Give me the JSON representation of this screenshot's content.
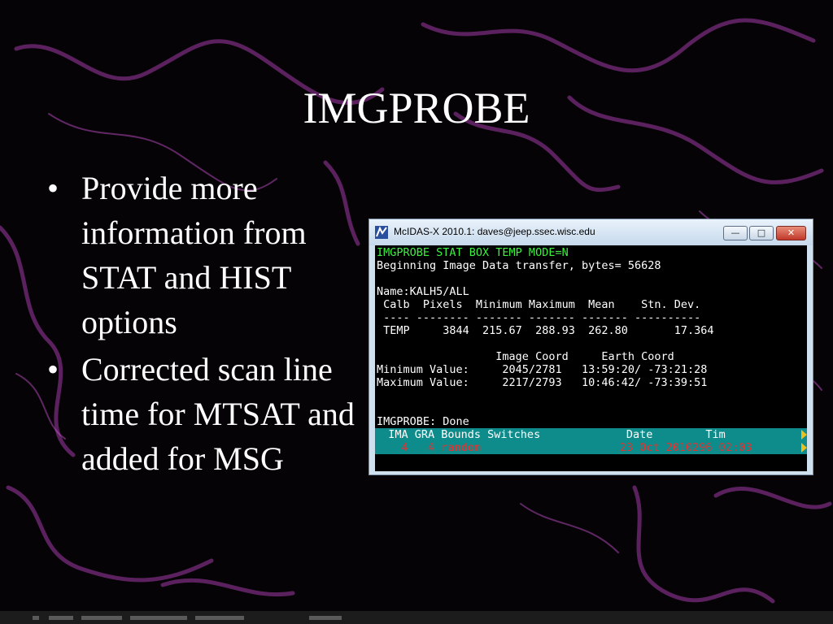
{
  "slide": {
    "title": "IMGPROBE",
    "bullets": [
      "Provide more information from STAT and HIST options",
      "Corrected scan line time for MTSAT and added for MSG"
    ],
    "bullet_char": "•"
  },
  "window": {
    "title": "McIDAS-X 2010.1: daves@jeep.ssec.wisc.edu",
    "controls": {
      "minimize": "—",
      "maximize": "□",
      "close": "✕"
    },
    "icons": {
      "app": "mcidas-app-icon"
    }
  },
  "console": {
    "command": "IMGPROBE STAT BOX TEMP MODE=N",
    "transfer": "Beginning Image Data transfer, bytes= 56628",
    "name_line": "Name:KALH5/ALL",
    "stats_header": " Calb  Pixels  Minimum Maximum  Mean    Stn. Dev.",
    "stats_rule": " ---- -------- ------- ------- ------- ----------",
    "stats_row": " TEMP     3844  215.67  288.93  262.80       17.364",
    "coord_header": "                  Image Coord     Earth Coord",
    "min_value": "Minimum Value:     2045/2781   13:59:20/ -73:21:28",
    "max_value": "Maximum Value:     2217/2793   10:46:42/ -73:39:51",
    "done": "IMGPROBE: Done",
    "status_header": "  IMA GRA Bounds Switches             Date        Tim",
    "status_values": "    4   4 random                     23 Oct 2010296 02:03"
  },
  "colors": {
    "command_text": "#3df040",
    "console_bg": "#000000",
    "status_bar_bg": "#0e8c8c",
    "status_values_text": "#e83030",
    "scroll_marker": "#e8c020"
  }
}
